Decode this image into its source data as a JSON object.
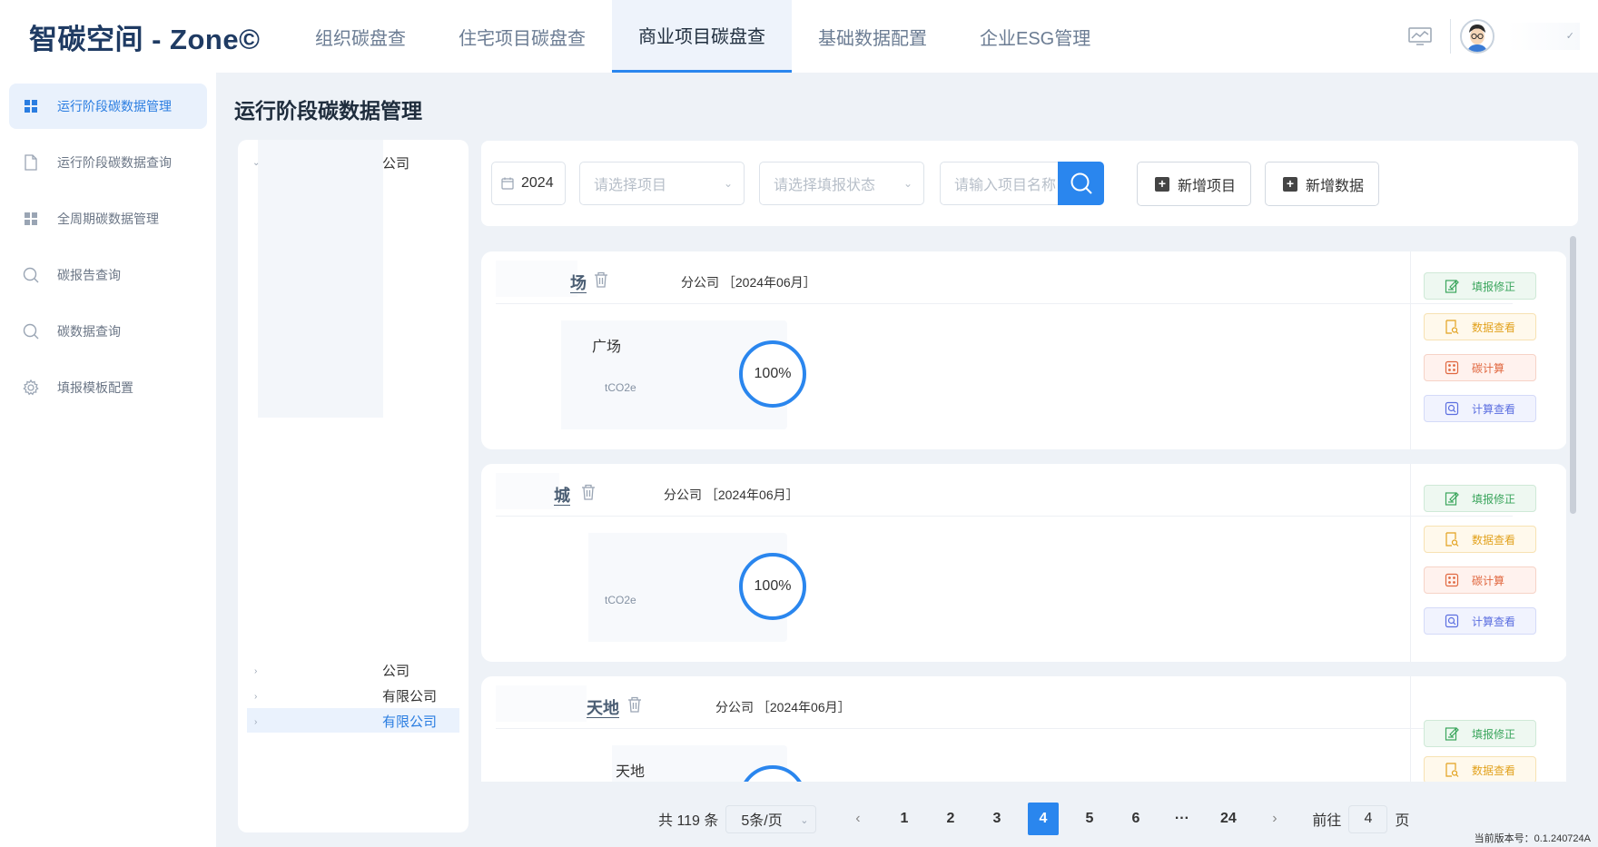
{
  "app": {
    "logo": "智碳空间 - Zone©",
    "nav": [
      {
        "label": "组织碳盘查"
      },
      {
        "label": "住宅项目碳盘查"
      },
      {
        "label": "商业项目碳盘查"
      },
      {
        "label": "基础数据配置"
      },
      {
        "label": "企业ESG管理"
      }
    ],
    "active_nav": "商业项目碳盘查"
  },
  "sidebar": {
    "items": [
      {
        "label": "运行阶段碳数据管理",
        "icon": "grid-icon",
        "active": true
      },
      {
        "label": "运行阶段碳数据查询",
        "icon": "file-icon"
      },
      {
        "label": "全周期碳数据管理",
        "icon": "grid-icon"
      },
      {
        "label": "碳报告查询",
        "icon": "search-icon"
      },
      {
        "label": "碳数据查询",
        "icon": "search-icon"
      },
      {
        "label": "填报模板配置",
        "icon": "gear-icon"
      }
    ]
  },
  "main": {
    "title": "运行阶段碳数据管理"
  },
  "tree": {
    "nodes": [
      "公司",
      "公司",
      "有限公司",
      "有限公司"
    ],
    "selected": "有限公司"
  },
  "toolbar": {
    "date_value": "2024",
    "project_placeholder": "请选择项目",
    "status_placeholder": "请选择填报状态",
    "search_placeholder": "请输入项目名称",
    "add_project_label": "新增项目",
    "add_data_label": "新增数据"
  },
  "cards": [
    {
      "name": "场",
      "branch": "分公司",
      "period": "［2024年06月］",
      "metric_title": "广场",
      "unit": "tCO2e",
      "progress": "100%"
    },
    {
      "name": "城",
      "branch": "分公司",
      "period": "［2024年06月］",
      "metric_title": "",
      "unit": "tCO2e",
      "progress": "100%"
    },
    {
      "name": "天地",
      "branch": "分公司",
      "period": "［2024年06月］",
      "metric_title": "天地",
      "unit": "",
      "progress": ""
    }
  ],
  "card_actions": {
    "fill_fix": "填报修正",
    "data_view": "数据查看",
    "carbon_calc": "碳计算",
    "calc_view": "计算查看"
  },
  "pagination": {
    "total": "共 119 条",
    "page_size": "5条/页",
    "pages": [
      "1",
      "2",
      "3",
      "4",
      "5",
      "6",
      "···",
      "24"
    ],
    "current": "4",
    "goto_prefix": "前往",
    "goto_value": "4",
    "goto_suffix": "页"
  },
  "version": "当前版本号：0.1.240724A",
  "colors": {
    "primary": "#2a86ee",
    "logo": "#1f3b63",
    "green": "#3aa55c",
    "yellow": "#e2a21e",
    "red": "#e0673f",
    "blue": "#5b6ee0"
  }
}
